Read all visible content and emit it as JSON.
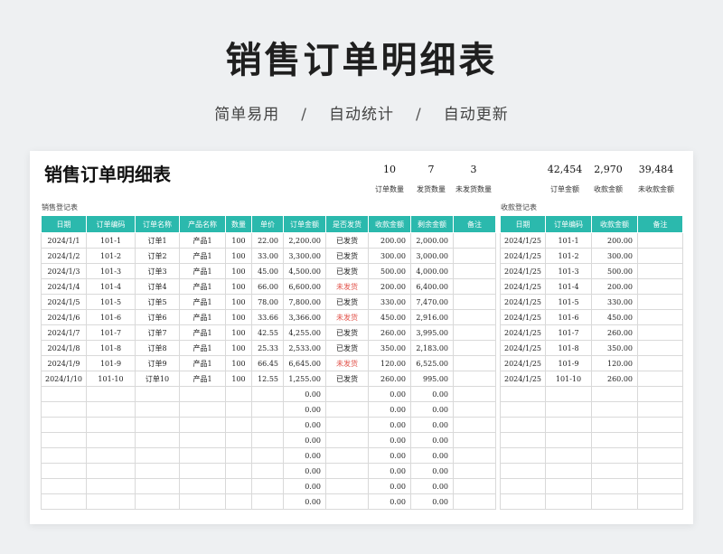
{
  "hero": {
    "title": "销售订单明细表",
    "subtitle_items": [
      "简单易用",
      "自动统计",
      "自动更新"
    ],
    "separator": "/"
  },
  "sheet": {
    "title": "销售订单明细表",
    "stats": [
      {
        "value": "10",
        "label": "订单数量"
      },
      {
        "value": "7",
        "label": "发货数量"
      },
      {
        "value": "3",
        "label": "未发货数量"
      },
      {
        "value": "42,454",
        "label": "订单金额"
      },
      {
        "value": "2,970",
        "label": "收款金额"
      },
      {
        "value": "39,484",
        "label": "未收款金额"
      }
    ],
    "sales_section_label": "销售登记表",
    "payment_section_label": "收款登记表",
    "accent_color": "#2bb9ad",
    "unshipped_color": "#e2534b"
  },
  "sales": {
    "headers": [
      "日期",
      "订单编码",
      "订单名称",
      "产品名称",
      "数量",
      "单价",
      "订单金额",
      "是否发货",
      "收款金额",
      "剩余金额",
      "备注"
    ],
    "rows": [
      [
        "2024/1/1",
        "101-1",
        "订单1",
        "产品1",
        "100",
        "22.00",
        "2,200.00",
        "已发货",
        "200.00",
        "2,000.00",
        ""
      ],
      [
        "2024/1/2",
        "101-2",
        "订单2",
        "产品1",
        "100",
        "33.00",
        "3,300.00",
        "已发货",
        "300.00",
        "3,000.00",
        ""
      ],
      [
        "2024/1/3",
        "101-3",
        "订单3",
        "产品1",
        "100",
        "45.00",
        "4,500.00",
        "已发货",
        "500.00",
        "4,000.00",
        ""
      ],
      [
        "2024/1/4",
        "101-4",
        "订单4",
        "产品1",
        "100",
        "66.00",
        "6,600.00",
        "未发货",
        "200.00",
        "6,400.00",
        ""
      ],
      [
        "2024/1/5",
        "101-5",
        "订单5",
        "产品1",
        "100",
        "78.00",
        "7,800.00",
        "已发货",
        "330.00",
        "7,470.00",
        ""
      ],
      [
        "2024/1/6",
        "101-6",
        "订单6",
        "产品1",
        "100",
        "33.66",
        "3,366.00",
        "未发货",
        "450.00",
        "2,916.00",
        ""
      ],
      [
        "2024/1/7",
        "101-7",
        "订单7",
        "产品1",
        "100",
        "42.55",
        "4,255.00",
        "已发货",
        "260.00",
        "3,995.00",
        ""
      ],
      [
        "2024/1/8",
        "101-8",
        "订单8",
        "产品1",
        "100",
        "25.33",
        "2,533.00",
        "已发货",
        "350.00",
        "2,183.00",
        ""
      ],
      [
        "2024/1/9",
        "101-9",
        "订单9",
        "产品1",
        "100",
        "66.45",
        "6,645.00",
        "未发货",
        "120.00",
        "6,525.00",
        ""
      ],
      [
        "2024/1/10",
        "101-10",
        "订单10",
        "产品1",
        "100",
        "12.55",
        "1,255.00",
        "已发货",
        "260.00",
        "995.00",
        ""
      ],
      [
        "",
        "",
        "",
        "",
        "",
        "",
        "0.00",
        "",
        "0.00",
        "0.00",
        ""
      ],
      [
        "",
        "",
        "",
        "",
        "",
        "",
        "0.00",
        "",
        "0.00",
        "0.00",
        ""
      ],
      [
        "",
        "",
        "",
        "",
        "",
        "",
        "0.00",
        "",
        "0.00",
        "0.00",
        ""
      ],
      [
        "",
        "",
        "",
        "",
        "",
        "",
        "0.00",
        "",
        "0.00",
        "0.00",
        ""
      ],
      [
        "",
        "",
        "",
        "",
        "",
        "",
        "0.00",
        "",
        "0.00",
        "0.00",
        ""
      ],
      [
        "",
        "",
        "",
        "",
        "",
        "",
        "0.00",
        "",
        "0.00",
        "0.00",
        ""
      ],
      [
        "",
        "",
        "",
        "",
        "",
        "",
        "0.00",
        "",
        "0.00",
        "0.00",
        ""
      ],
      [
        "",
        "",
        "",
        "",
        "",
        "",
        "0.00",
        "",
        "0.00",
        "0.00",
        ""
      ]
    ]
  },
  "payments": {
    "headers": [
      "日期",
      "订单编码",
      "收款金额",
      "备注"
    ],
    "rows": [
      [
        "2024/1/25",
        "101-1",
        "200.00",
        ""
      ],
      [
        "2024/1/25",
        "101-2",
        "300.00",
        ""
      ],
      [
        "2024/1/25",
        "101-3",
        "500.00",
        ""
      ],
      [
        "2024/1/25",
        "101-4",
        "200.00",
        ""
      ],
      [
        "2024/1/25",
        "101-5",
        "330.00",
        ""
      ],
      [
        "2024/1/25",
        "101-6",
        "450.00",
        ""
      ],
      [
        "2024/1/25",
        "101-7",
        "260.00",
        ""
      ],
      [
        "2024/1/25",
        "101-8",
        "350.00",
        ""
      ],
      [
        "2024/1/25",
        "101-9",
        "120.00",
        ""
      ],
      [
        "2024/1/25",
        "101-10",
        "260.00",
        ""
      ],
      [
        "",
        "",
        "",
        ""
      ],
      [
        "",
        "",
        "",
        ""
      ],
      [
        "",
        "",
        "",
        ""
      ],
      [
        "",
        "",
        "",
        ""
      ],
      [
        "",
        "",
        "",
        ""
      ],
      [
        "",
        "",
        "",
        ""
      ],
      [
        "",
        "",
        "",
        ""
      ],
      [
        "",
        "",
        "",
        ""
      ]
    ]
  }
}
